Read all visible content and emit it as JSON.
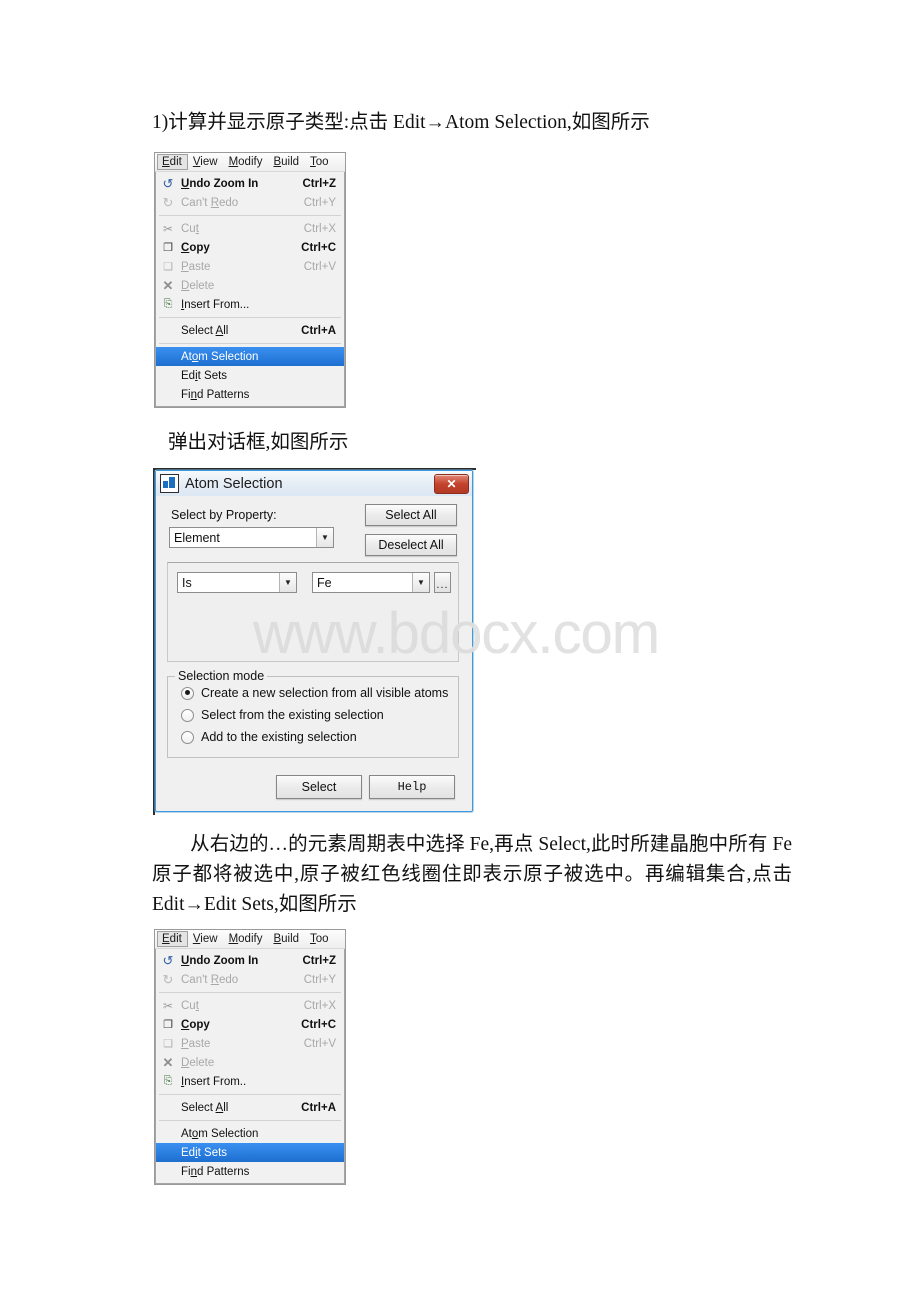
{
  "document": {
    "heading_line": "1)计算并显示原子类型:点击 Edit→Atom Selection,如图所示",
    "caption_dialog": "弹出对话框,如图所示",
    "paragraph": "从右边的…的元素周期表中选择 Fe,再点 Select,此时所建晶胞中所有 Fe 原子都将被选中,原子被红色线圈住即表示原子被选中。再编辑集合,点击 Edit→Edit Sets,如图所示"
  },
  "watermark": {
    "text": "www.bdocx.com",
    "color": "#dddddd"
  },
  "menu": {
    "menubar": [
      {
        "label": "Edit",
        "mnemonic": "E",
        "active": true
      },
      {
        "label": "View",
        "mnemonic": "V",
        "active": false
      },
      {
        "label": "Modify",
        "mnemonic": "M",
        "active": false
      },
      {
        "label": "Build",
        "mnemonic": "B",
        "active": false
      },
      {
        "label": "Too",
        "mnemonic": "T",
        "active": false
      }
    ],
    "items_1": [
      {
        "icon": "undo-icon",
        "label": "Undo Zoom In",
        "mnemonic": "U",
        "accel": "Ctrl+Z",
        "state": "enabled",
        "highlight": false
      },
      {
        "icon": "redo-icon",
        "label": "Can't Redo",
        "mnemonic": "R",
        "accel": "Ctrl+Y",
        "state": "disabled",
        "highlight": false
      },
      {
        "separator": true
      },
      {
        "icon": "cut-icon",
        "label": "Cut",
        "mnemonic": "t",
        "accel": "Ctrl+X",
        "state": "disabled",
        "highlight": false
      },
      {
        "icon": "copy-icon",
        "label": "Copy",
        "mnemonic": "C",
        "accel": "Ctrl+C",
        "state": "enabled",
        "highlight": false
      },
      {
        "icon": "paste-icon",
        "label": "Paste",
        "mnemonic": "P",
        "accel": "Ctrl+V",
        "state": "disabled",
        "highlight": false
      },
      {
        "icon": "delete-icon",
        "label": "Delete",
        "mnemonic": "D",
        "accel": "",
        "state": "disabled",
        "highlight": false
      },
      {
        "icon": "insert-from-icon",
        "label": "Insert From...",
        "mnemonic": "I",
        "accel": "",
        "state": "enabled",
        "highlight": false
      },
      {
        "separator": true
      },
      {
        "icon": "",
        "label": "Select All",
        "mnemonic": "A",
        "accel": "Ctrl+A",
        "state": "enabled",
        "highlight": false
      },
      {
        "separator": true
      },
      {
        "icon": "",
        "label": "Atom Selection",
        "mnemonic": "o",
        "accel": "",
        "state": "enabled",
        "highlight": true
      },
      {
        "icon": "",
        "label": "Edit Sets",
        "mnemonic": "i",
        "accel": "",
        "state": "enabled",
        "highlight": false
      },
      {
        "icon": "",
        "label": "Find Patterns",
        "mnemonic": "n",
        "accel": "",
        "state": "enabled",
        "highlight": false
      }
    ],
    "items_2": [
      {
        "icon": "undo-icon",
        "label": "Undo Zoom In",
        "mnemonic": "U",
        "accel": "Ctrl+Z",
        "state": "enabled",
        "highlight": false
      },
      {
        "icon": "redo-icon",
        "label": "Can't Redo",
        "mnemonic": "R",
        "accel": "Ctrl+Y",
        "state": "disabled",
        "highlight": false
      },
      {
        "separator": true
      },
      {
        "icon": "cut-icon",
        "label": "Cut",
        "mnemonic": "t",
        "accel": "Ctrl+X",
        "state": "disabled",
        "highlight": false
      },
      {
        "icon": "copy-icon",
        "label": "Copy",
        "mnemonic": "C",
        "accel": "Ctrl+C",
        "state": "enabled",
        "highlight": false
      },
      {
        "icon": "paste-icon",
        "label": "Paste",
        "mnemonic": "P",
        "accel": "Ctrl+V",
        "state": "disabled",
        "highlight": false
      },
      {
        "icon": "delete-icon",
        "label": "Delete",
        "mnemonic": "D",
        "accel": "",
        "state": "disabled",
        "highlight": false
      },
      {
        "icon": "insert-from-icon",
        "label": "Insert From..",
        "mnemonic": "I",
        "accel": "",
        "state": "enabled",
        "highlight": false
      },
      {
        "separator": true
      },
      {
        "icon": "",
        "label": "Select All",
        "mnemonic": "A",
        "accel": "Ctrl+A",
        "state": "enabled",
        "highlight": false
      },
      {
        "separator": true
      },
      {
        "icon": "",
        "label": "Atom Selection",
        "mnemonic": "o",
        "accel": "",
        "state": "enabled",
        "highlight": false
      },
      {
        "icon": "",
        "label": "Edit Sets",
        "mnemonic": "i",
        "accel": "",
        "state": "enabled",
        "highlight": true
      },
      {
        "icon": "",
        "label": "Find Patterns",
        "mnemonic": "n",
        "accel": "",
        "state": "enabled",
        "highlight": false
      }
    ]
  },
  "dialog": {
    "title": "Atom Selection",
    "close_label": "✕",
    "select_by_property_label": "Select by Property:",
    "property_value": "Element",
    "select_all_label": "Select All",
    "deselect_all_label": "Deselect All",
    "operator_value": "Is",
    "value_value": "Fe",
    "ellipsis_label": "...",
    "selection_mode_title": "Selection mode",
    "modes": [
      {
        "label": "Create a new selection from all visible atoms",
        "checked": true
      },
      {
        "label": "Select from the existing selection",
        "checked": false
      },
      {
        "label": "Add to the existing selection",
        "checked": false
      }
    ],
    "select_button": "Select",
    "help_button": "Help"
  }
}
